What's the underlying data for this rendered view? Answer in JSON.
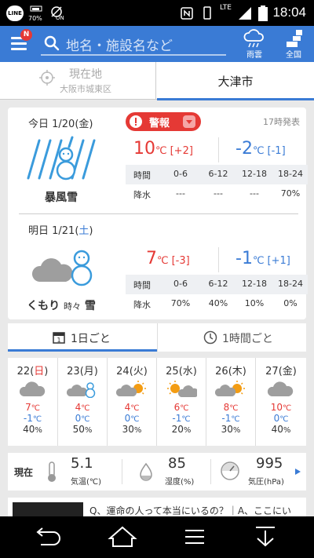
{
  "status": {
    "time": "18:04",
    "battery": "70%",
    "network": "LTE",
    "ticker_on": "ON",
    "line": "LINE"
  },
  "appbar": {
    "search_placeholder": "地名・施設名など",
    "menu_badge": "N",
    "rain_cloud_label": "雨雲",
    "nationwide_label": "全国"
  },
  "location_tabs": {
    "current_label": "現在地",
    "current_sub": "大阪市城東区",
    "selected": "大津市"
  },
  "forecast": {
    "announce": "17時発表",
    "warning": "警報",
    "rain_headers": {
      "time": "時間",
      "rain": "降水"
    },
    "periods": [
      "0-6",
      "6-12",
      "12-18",
      "18-24"
    ],
    "days": [
      {
        "date_prefix": "今日 1/20(",
        "weekday": "金",
        "date_suffix": ")",
        "weekday_color": "#333333",
        "condition": "暴風雪",
        "condition_extra": "",
        "condition_main2": "",
        "icon": "snowstorm-snowman-icon",
        "high": "10",
        "high_diff": "[+2]",
        "low": "-2",
        "low_diff": "[-1]",
        "rain": [
          "---",
          "---",
          "---",
          "70%"
        ]
      },
      {
        "date_prefix": "明日 1/21(",
        "weekday": "土",
        "date_suffix": ")",
        "weekday_color": "#3a7bd5",
        "condition": "くもり",
        "condition_extra": "時々",
        "condition_main2": "雪",
        "icon": "cloud-snowman-icon",
        "high": "7",
        "high_diff": "[-3]",
        "low": "-1",
        "low_diff": "[+1]",
        "rain": [
          "70%",
          "40%",
          "10%",
          "0%"
        ]
      }
    ],
    "unit": "℃"
  },
  "mode_tabs": {
    "daily": "1日ごと",
    "hourly": "1時間ごと"
  },
  "week": [
    {
      "day": "22",
      "wd": "日",
      "wd_color": "#e53935",
      "icon": "cloud-icon",
      "high": "7",
      "low": "-1",
      "pop": "40"
    },
    {
      "day": "23",
      "wd": "月",
      "wd_color": "#333333",
      "icon": "cloud-snowman-icon",
      "high": "4",
      "low": "0",
      "pop": "50"
    },
    {
      "day": "24",
      "wd": "火",
      "wd_color": "#333333",
      "icon": "cloud-sun-icon",
      "high": "4",
      "low": "0",
      "pop": "30"
    },
    {
      "day": "25",
      "wd": "水",
      "wd_color": "#333333",
      "icon": "sun-cloud-icon",
      "high": "6",
      "low": "-1",
      "pop": "20"
    },
    {
      "day": "26",
      "wd": "木",
      "wd_color": "#333333",
      "icon": "cloud-sun-icon",
      "high": "8",
      "low": "-1",
      "pop": "30"
    },
    {
      "day": "27",
      "wd": "金",
      "wd_color": "#333333",
      "icon": "cloud-icon",
      "high": "10",
      "low": "0",
      "pop": "40"
    }
  ],
  "week_units": {
    "temp": "℃",
    "pct": "%"
  },
  "current": {
    "label": "現在",
    "temp": "5.1",
    "temp_label": "気温(℃)",
    "humidity": "85",
    "humidity_label": "湿度(%)",
    "pressure": "995",
    "pressure_label": "気圧(hPa)"
  },
  "news": {
    "text": "Q、運命の人って本当にいるの？｜A、ここにい"
  },
  "colors": {
    "accent": "#3a7bd5",
    "high": "#e53935",
    "low": "#3a7bd5"
  }
}
